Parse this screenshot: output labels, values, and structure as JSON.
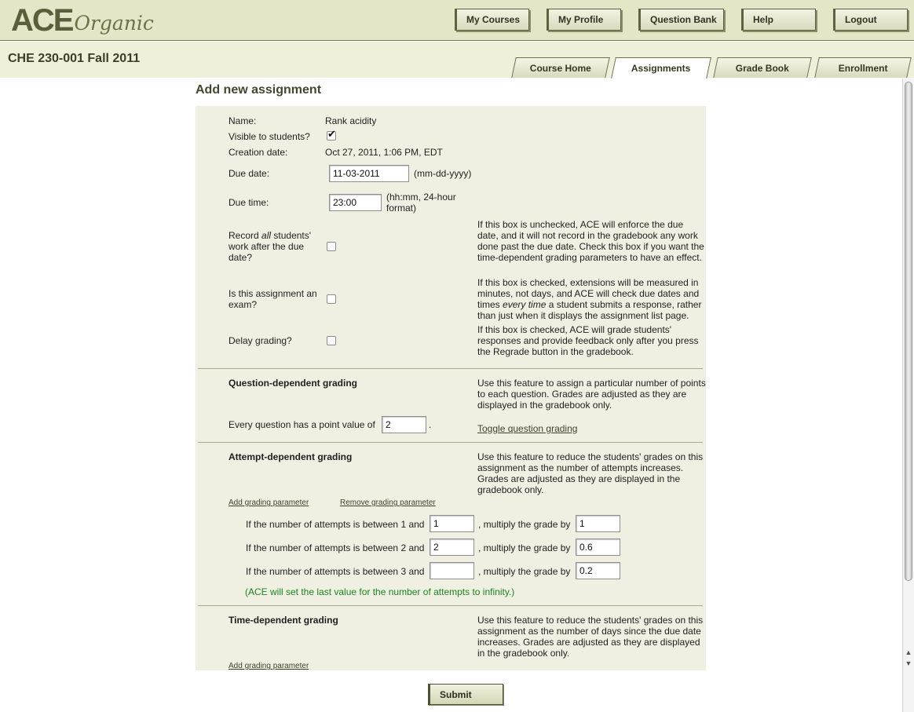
{
  "logo": {
    "ace": "ACE",
    "organic": "Organic"
  },
  "topnav": {
    "my_courses": "My Courses",
    "my_profile": "My Profile",
    "question_bank": "Question Bank",
    "help": "Help",
    "logout": "Logout"
  },
  "course": {
    "title": "CHE 230-001 Fall 2011"
  },
  "tabs": {
    "course_home": "Course Home",
    "assignments": "Assignments",
    "grade_book": "Grade Book",
    "enrollment": "Enrollment"
  },
  "page": {
    "title": "Add new assignment"
  },
  "form": {
    "name_label": "Name:",
    "name_value": "Rank acidity",
    "visible_label": "Visible to students?",
    "visible_checked": true,
    "creation_label": "Creation date:",
    "creation_value": "Oct 27, 2011, 1:06 PM, EDT",
    "due_date_label": "Due date:",
    "due_date_value": "11-03-2011",
    "due_date_hint": "(mm-dd-yyyy)",
    "due_time_label": "Due time:",
    "due_time_value": "23:00",
    "due_time_hint_1": "(hh:mm, 24-hour",
    "due_time_hint_2": "format)",
    "record_label_1": "Record ",
    "record_label_all": "all",
    "record_label_2": " students'",
    "record_label_3": "work after the due",
    "record_label_4": "date?",
    "record_desc": "If this box is unchecked, ACE will enforce the due date, and it will not record in the gradebook any work done past the due date. Check this box if you want the time-dependent grading parameters to have an effect.",
    "exam_label_1": "Is this assignment an",
    "exam_label_2": "exam?",
    "exam_desc_1": "If this box is checked, extensions will be measured in minutes, not days, and ACE will check due dates and times ",
    "exam_desc_em": "every time",
    "exam_desc_2": " a student submits a response, rather than just when it displays the assignment list page.",
    "delay_label": "Delay grading?",
    "delay_desc": "If this box is checked, ACE will grade students' responses and provide feedback only after you press the Regrade button in the gradebook."
  },
  "question_grading": {
    "heading": "Question-dependent grading",
    "desc": "Use this feature to assign a particular number of points to each question. Grades are adjusted as they are displayed in the gradebook only.",
    "point_label": "Every question has a point value of",
    "point_value": "2",
    "point_suffix": ".",
    "toggle_link": "Toggle question grading"
  },
  "attempt_grading": {
    "heading": "Attempt-dependent grading",
    "desc": "Use this feature to reduce the students' grades on this assignment as the number of attempts increases. Grades are adjusted as they are displayed in the gradebook only.",
    "add_link": "Add grading parameter",
    "remove_link": "Remove grading parameter",
    "mid_label": ", multiply the grade by",
    "rows": [
      {
        "label": "If the number of attempts is between 1 and",
        "attempts": "1",
        "multiplier": "1"
      },
      {
        "label": "If the number of attempts is between 2 and",
        "attempts": "2",
        "multiplier": "0.6"
      },
      {
        "label": "If the number of attempts is between 3 and",
        "attempts": "",
        "multiplier": "0.2"
      }
    ],
    "note": "(ACE will set the last value for the number of attempts to infinity.)"
  },
  "time_grading": {
    "heading": "Time-dependent grading",
    "desc": "Use this feature to reduce the students' grades on this assignment as the number of days since the due date increases. Grades are adjusted as they are displayed in the gradebook only.",
    "add_link": "Add grading parameter"
  },
  "submit_label": "Submit"
}
